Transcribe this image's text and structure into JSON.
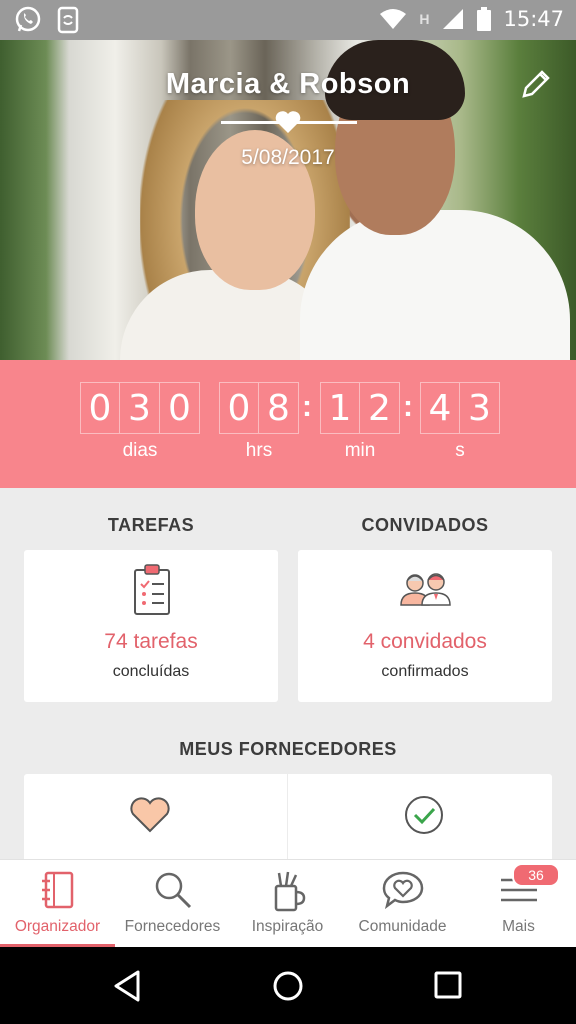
{
  "status_bar": {
    "time": "15:47",
    "network_indicator": "H"
  },
  "hero": {
    "couple_names": "Marcia & Robson",
    "date": "5/08/2017"
  },
  "countdown": {
    "days_digits": [
      "0",
      "3",
      "0"
    ],
    "hours_digits": [
      "0",
      "8"
    ],
    "minutes_digits": [
      "1",
      "2"
    ],
    "seconds_digits": [
      "4",
      "3"
    ],
    "labels": {
      "days": "dias",
      "hours": "hrs",
      "minutes": "min",
      "seconds": "s"
    }
  },
  "summary": {
    "tasks": {
      "title": "TAREFAS",
      "count_label": "74 tarefas",
      "status": "concluídas"
    },
    "guests": {
      "title": "CONVIDADOS",
      "count_label": "4 convidados",
      "status": "confirmados"
    }
  },
  "vendors": {
    "title": "MEUS FORNECEDORES"
  },
  "bottom_nav": {
    "items": [
      {
        "label": "Organizador",
        "icon": "notebook-icon",
        "active": true
      },
      {
        "label": "Fornecedores",
        "icon": "search-icon"
      },
      {
        "label": "Inspiração",
        "icon": "pencil-cup-icon"
      },
      {
        "label": "Comunidade",
        "icon": "heart-chat-icon"
      },
      {
        "label": "Mais",
        "icon": "menu-icon",
        "badge": "36"
      }
    ]
  },
  "colors": {
    "accent": "#f8858c",
    "accent_text": "#e2626b",
    "background": "#ececec"
  }
}
